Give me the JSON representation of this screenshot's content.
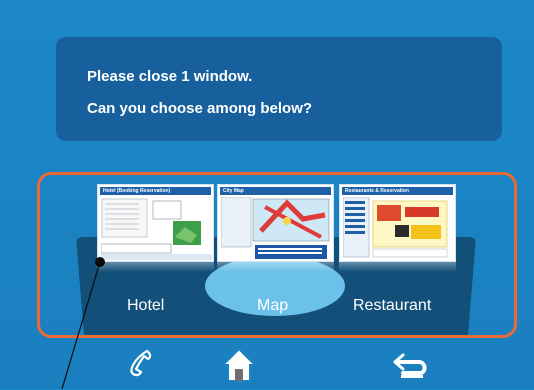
{
  "dialog": {
    "line1": "Please close 1 window.",
    "line2": "Can you choose among below?"
  },
  "windows": [
    {
      "label": "Hotel",
      "thumb_title": "Hotel (Booking Reservation)"
    },
    {
      "label": "Map",
      "thumb_title": "City Map"
    },
    {
      "label": "Restaurant",
      "thumb_title": "Restaurants & Reservation"
    }
  ],
  "softkeys": {
    "phone": "phone-icon",
    "home": "home-icon",
    "back": "back-icon"
  },
  "colors": {
    "background": "#1b84c4",
    "dialog": "#17609d",
    "selector_border": "#ea6a36",
    "stage": "#12507a",
    "map_highlight": "#6bc1e9"
  }
}
